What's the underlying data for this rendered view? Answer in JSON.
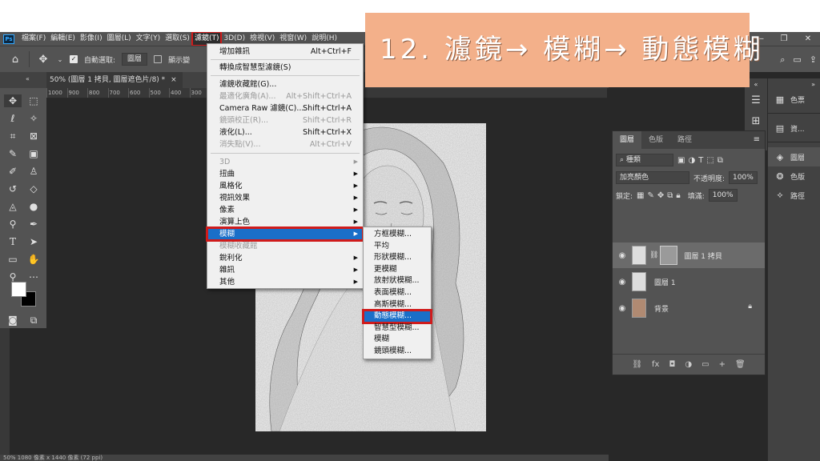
{
  "menubar": {
    "logo": "Ps",
    "items": [
      "檔案(F)",
      "編輯(E)",
      "影像(I)",
      "圖層(L)",
      "文字(Y)",
      "選取(S)",
      "濾鏡(T)",
      "3D(D)",
      "檢視(V)",
      "視窗(W)",
      "說明(H)"
    ],
    "window_controls": [
      "—",
      "❐",
      "✕"
    ]
  },
  "optbar": {
    "auto_select_label": "自動選取:",
    "auto_select_value": "圖層",
    "show_transform_label": "顯示變"
  },
  "document": {
    "tab_title": "50% (圖層 1 拷貝, 圖層遮色片/8) *",
    "close": "×",
    "ruler_ticks": [
      "1000",
      "900",
      "800",
      "700",
      "600",
      "500",
      "400",
      "300"
    ],
    "status": "50%    1080 像素 x 1440 像素 (72 ppi)"
  },
  "filter_menu": {
    "items": [
      {
        "label": "增加雜訊",
        "shortcut": "Alt+Ctrl+F"
      },
      {
        "label": "轉換成智慧型濾鏡(S)",
        "shortcut": ""
      },
      {
        "label": "濾鏡收藏館(G)...",
        "shortcut": ""
      },
      {
        "label": "最適化廣角(A)...",
        "shortcut": "Alt+Shift+Ctrl+A"
      },
      {
        "label": "Camera Raw 濾鏡(C)...",
        "shortcut": "Shift+Ctrl+A"
      },
      {
        "label": "鏡頭校正(R)...",
        "shortcut": "Shift+Ctrl+R"
      },
      {
        "label": "液化(L)...",
        "shortcut": "Shift+Ctrl+X"
      },
      {
        "label": "消失點(V)...",
        "shortcut": "Alt+Ctrl+V"
      },
      {
        "label": "3D"
      },
      {
        "label": "扭曲"
      },
      {
        "label": "風格化"
      },
      {
        "label": "視訊效果"
      },
      {
        "label": "像素"
      },
      {
        "label": "演算上色"
      },
      {
        "label": "模糊"
      },
      {
        "label": "模糊收藏館"
      },
      {
        "label": "銳利化"
      },
      {
        "label": "雜訊"
      },
      {
        "label": "其他"
      }
    ]
  },
  "blur_menu": {
    "items": [
      "方框模糊...",
      "平均",
      "形狀模糊...",
      "更模糊",
      "放射狀模糊...",
      "表面模糊...",
      "高斯模糊...",
      "動態模糊...",
      "智慧型模糊...",
      "模糊",
      "鏡頭模糊..."
    ]
  },
  "caption": "12. 濾鏡→ 模糊→ 動態模糊",
  "dock": {
    "items": [
      "色票",
      "資...",
      "圖層",
      "色版",
      "路徑"
    ]
  },
  "layers_panel": {
    "tabs": [
      "圖層",
      "色版",
      "路徑"
    ],
    "menu": "≡",
    "filter_label": "種類",
    "blend_mode": "加亮顏色",
    "opacity_label": "不透明度:",
    "opacity_value": "100%",
    "lock_label": "鎖定:",
    "fill_label": "填滿:",
    "fill_value": "100%",
    "layers": [
      {
        "name": "圖層 1 拷貝"
      },
      {
        "name": "圖層 1"
      },
      {
        "name": "背景"
      }
    ],
    "footer_icons": [
      "⛓",
      "fx",
      "◘",
      "◑",
      "▭",
      "+",
      "🗑"
    ]
  }
}
